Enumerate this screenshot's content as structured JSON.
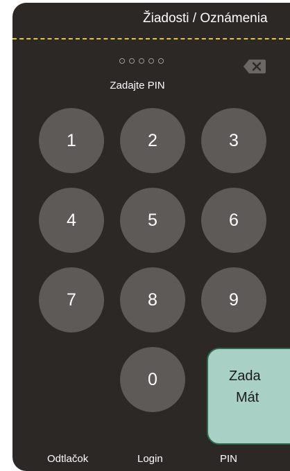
{
  "header": {
    "title": "Žiadosti / Oznámenia"
  },
  "pin": {
    "label": "Zadajte PIN",
    "dot_count": 5
  },
  "keypad": {
    "keys": [
      "1",
      "2",
      "3",
      "4",
      "5",
      "6",
      "7",
      "8",
      "9",
      "0"
    ]
  },
  "tooltip": {
    "line1": "Zada",
    "line2": "Mát"
  },
  "tabs": [
    {
      "label": "Odtlačok"
    },
    {
      "label": "Login"
    },
    {
      "label": "PIN"
    }
  ],
  "colors": {
    "background": "#2b2826",
    "key": "#5d5a57",
    "accent_dashed": "#e8c82a",
    "tooltip_bg": "#a8d0c4",
    "tooltip_border": "#2d6a4d"
  },
  "icons": {
    "backspace": "backspace-icon"
  }
}
